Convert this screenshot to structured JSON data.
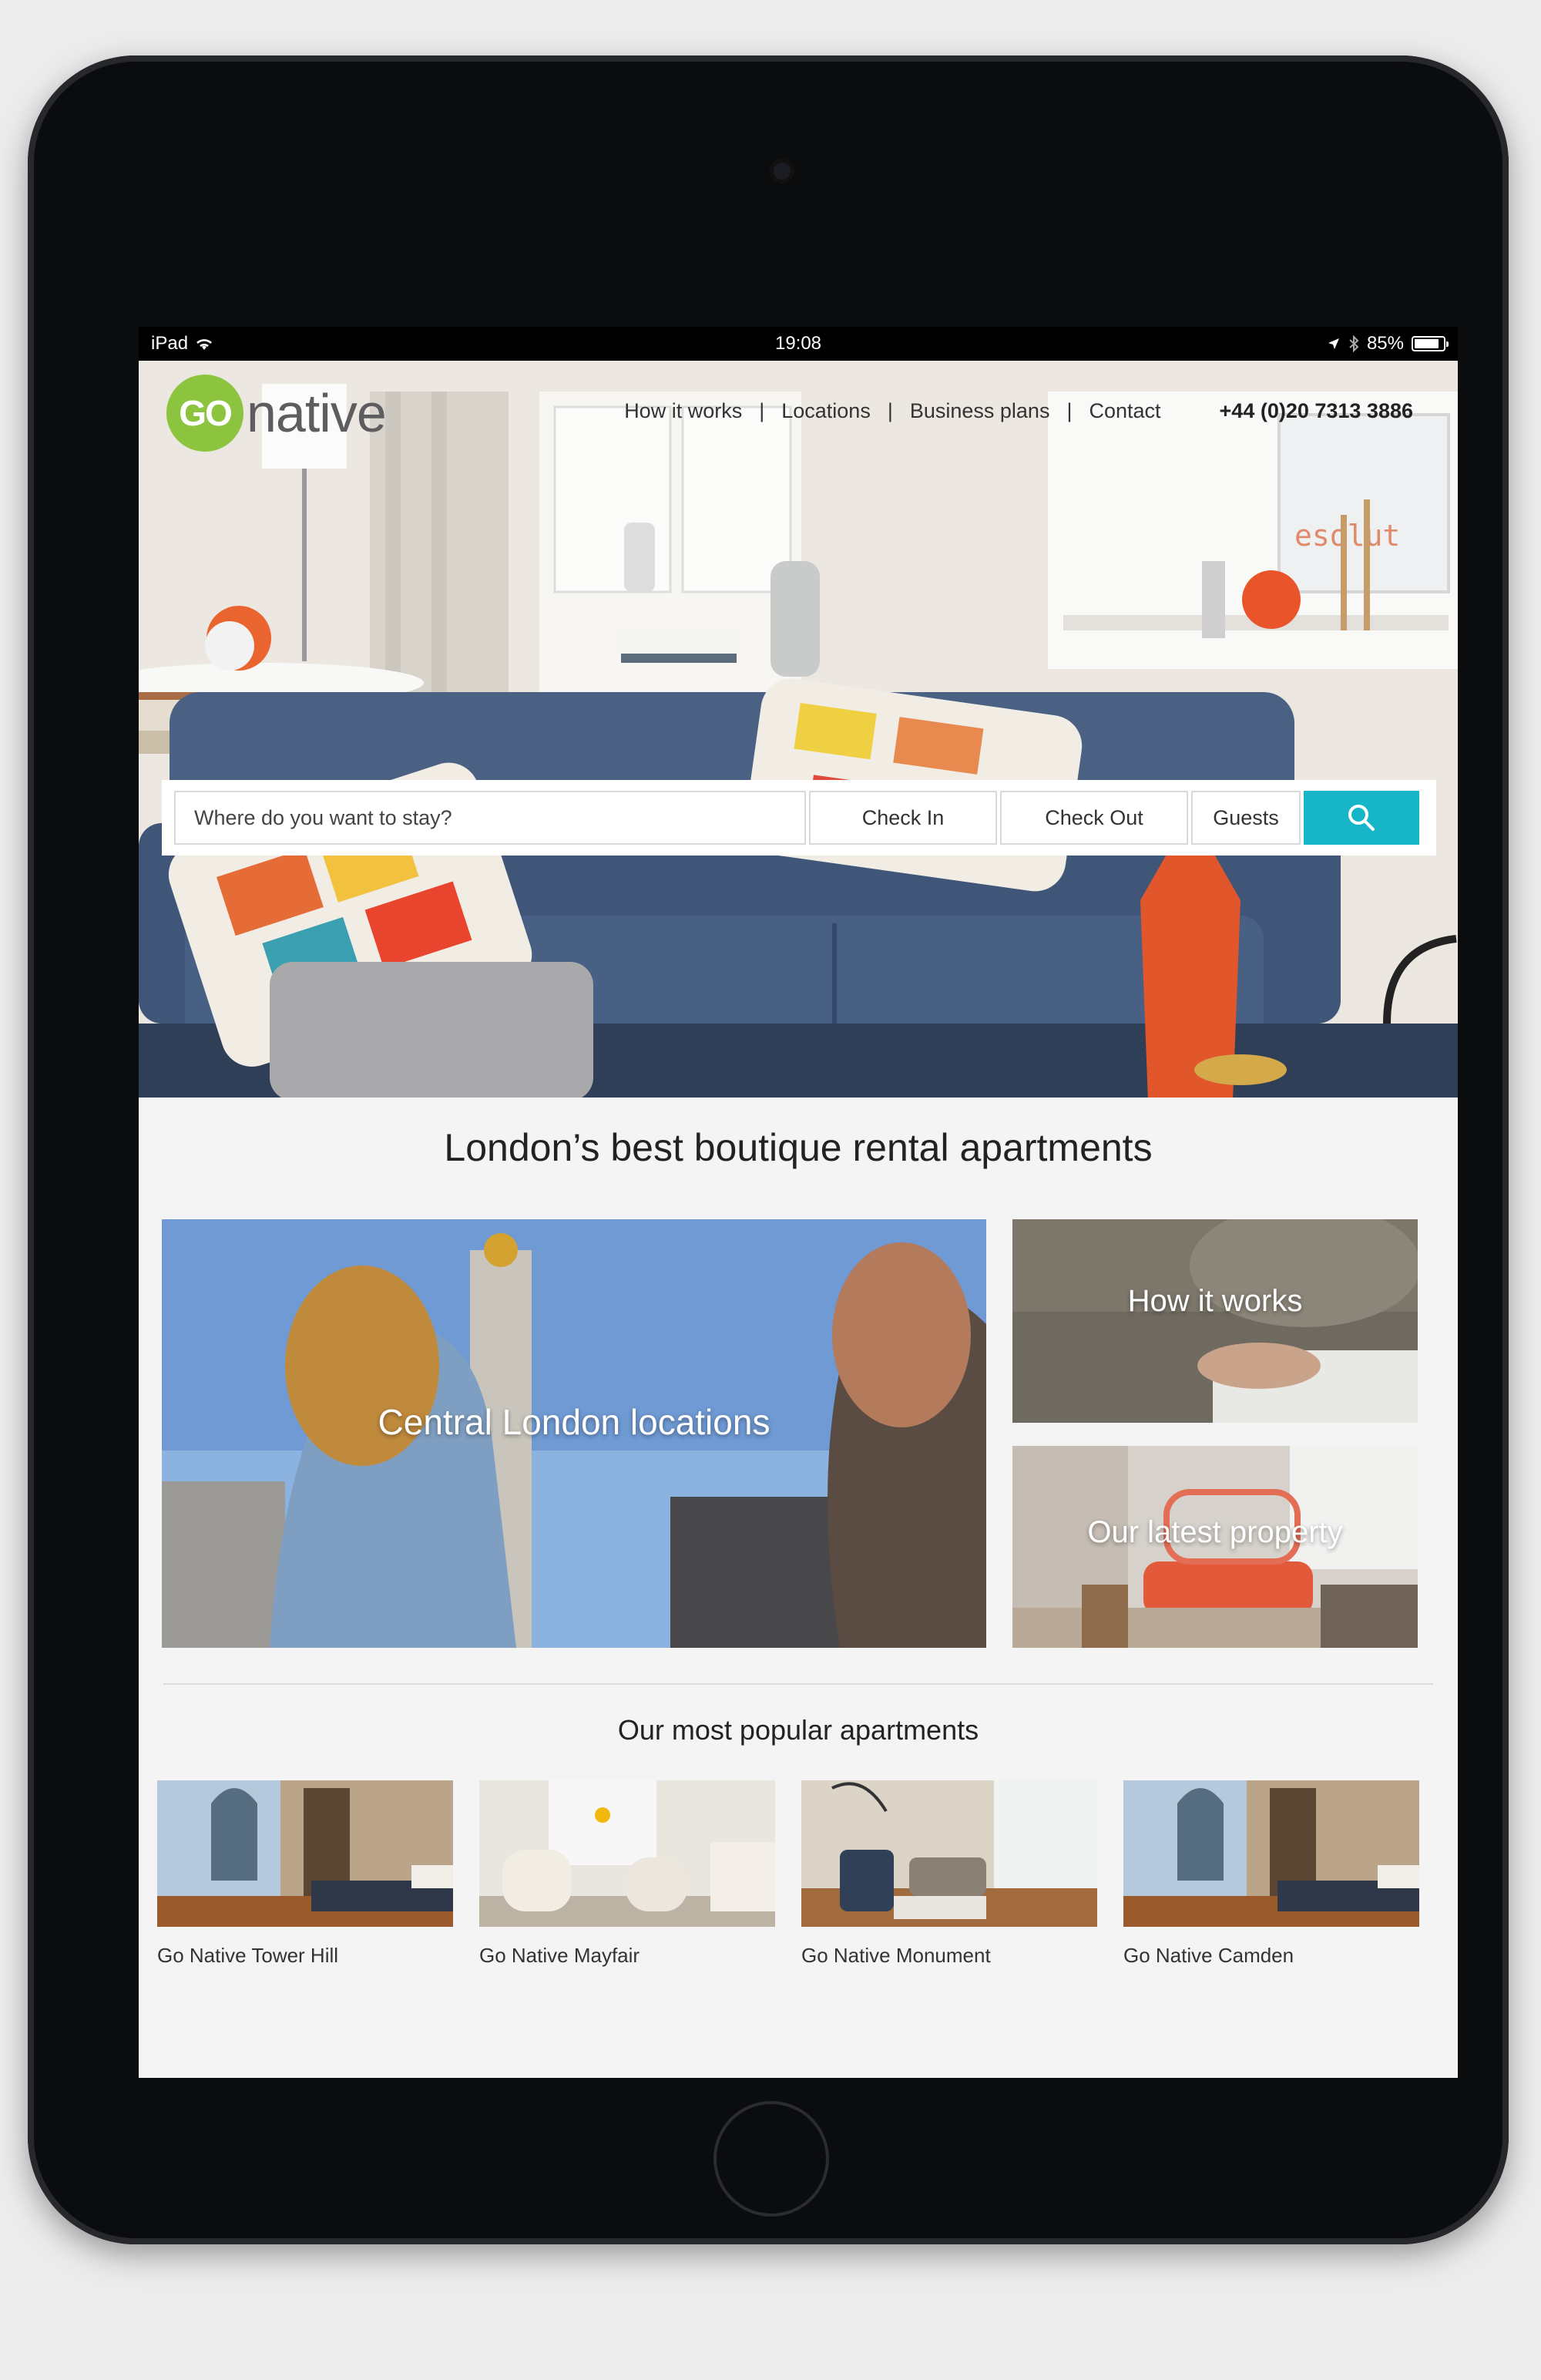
{
  "status_bar": {
    "device": "iPad",
    "time": "19:08",
    "battery": "85%",
    "battery_level": 0.85
  },
  "header": {
    "logo_go": "GO",
    "logo_native": "native",
    "nav": [
      {
        "label": "How it works"
      },
      {
        "label": "Locations"
      },
      {
        "label": "Business plans"
      },
      {
        "label": "Contact"
      }
    ],
    "phone": "+44 (0)20 7313 3886"
  },
  "hero_sign": "esolut",
  "search": {
    "placeholder": "Where do you want to stay?",
    "check_in": "Check In",
    "check_out": "Check Out",
    "guests": "Guests",
    "button_icon": "search-icon",
    "accent": "#16b5c7"
  },
  "main": {
    "headline": "London’s best boutique rental apartments",
    "tiles": [
      {
        "label": "Central London locations"
      },
      {
        "label": "How it works"
      },
      {
        "label": "Our latest property"
      }
    ],
    "popular_title": "Our most popular apartments",
    "apartments": [
      {
        "name": "Go Native Tower Hill"
      },
      {
        "name": "Go Native Mayfair"
      },
      {
        "name": "Go Native Monument"
      },
      {
        "name": "Go Native Camden"
      }
    ]
  },
  "brand": {
    "green": "#8cc43f",
    "grey": "#5d5d5f"
  }
}
